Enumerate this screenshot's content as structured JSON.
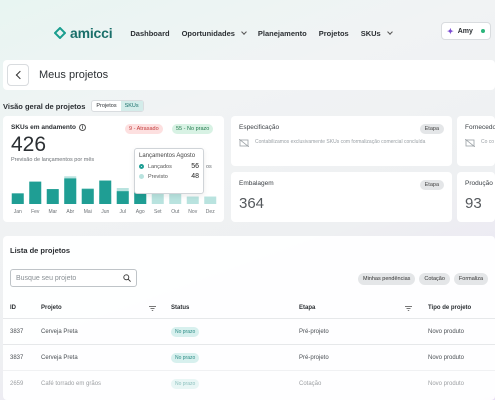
{
  "header": {
    "logo_text": "amicci",
    "nav": [
      {
        "label": "Dashboard",
        "has_dropdown": false
      },
      {
        "label": "Oportunidades",
        "has_dropdown": true
      },
      {
        "label": "Planejamento",
        "has_dropdown": false
      },
      {
        "label": "Projetos",
        "has_dropdown": false
      },
      {
        "label": "SKUs",
        "has_dropdown": true
      }
    ],
    "user_name": "Amy"
  },
  "page": {
    "title": "Meus projetos"
  },
  "overview": {
    "title": "Visão geral de projetos",
    "toggle": [
      "Projetos",
      "SKUs"
    ],
    "toggle_active": "SKUs",
    "skus_card": {
      "label": "SKUs em andamento",
      "count": "426",
      "sublabel": "Previsão de lançamentos por mês",
      "badge_late": "9 - Atrasado",
      "badge_ok": "55 - No prazo"
    },
    "tooltip": {
      "title": "Lançamentos Agosto",
      "rows": [
        {
          "label": "Lançados",
          "value": "56",
          "color": "#1f9e94"
        },
        {
          "label": "Previsto",
          "value": "48",
          "color": "#b9e3df"
        }
      ],
      "trailing": "os"
    },
    "cards": [
      {
        "title": "Especificação",
        "badge": "Etapa",
        "empty_text": "Contabilizamos exclusivamente SKUs com formalização comercial concluída"
      },
      {
        "title": "Fornecedor",
        "badge": "",
        "empty_text": "Co co"
      },
      {
        "title": "Embalagem",
        "badge": "Etapa",
        "value": "364"
      },
      {
        "title": "Produção",
        "badge": "",
        "value": "93"
      }
    ]
  },
  "chart_data": {
    "type": "bar",
    "categories": [
      "Jan",
      "Fev",
      "Mar",
      "Abr",
      "Mai",
      "Jun",
      "Jul",
      "Ago",
      "Set",
      "Out",
      "Nov",
      "Dez"
    ],
    "series": [
      {
        "name": "Lançados",
        "values": [
          20,
          42,
          28,
          48,
          28,
          44,
          24,
          56,
          0,
          0,
          0,
          0
        ]
      },
      {
        "name": "Previsto",
        "values": [
          10,
          10,
          8,
          52,
          30,
          16,
          30,
          48,
          22,
          22,
          14,
          14
        ]
      }
    ],
    "colors": {
      "launched": "#1f9e94",
      "forecast": "#b9e3df"
    },
    "ylim": [
      0,
      60
    ],
    "grid": false
  },
  "list": {
    "title": "Lista de projetos",
    "search_placeholder": "Busque seu projeto",
    "chips": [
      "Minhas pendências",
      "Cotação",
      "Formaliza"
    ],
    "columns": [
      "ID",
      "Projeto",
      "Status",
      "Etapa",
      "Tipo de projeto"
    ],
    "rows": [
      {
        "id": "3837",
        "project": "Cerveja Preta",
        "status": "No prazo",
        "stage": "Pré-projeto",
        "type": "Novo produto"
      },
      {
        "id": "3837",
        "project": "Cerveja Preta",
        "status": "No prazo",
        "stage": "Pré-projeto",
        "type": "Novo produto"
      },
      {
        "id": "2659",
        "project": "Café torrado em grãos",
        "status": "No prazo",
        "stage": "Cotação",
        "type": "Novo produto"
      }
    ]
  }
}
